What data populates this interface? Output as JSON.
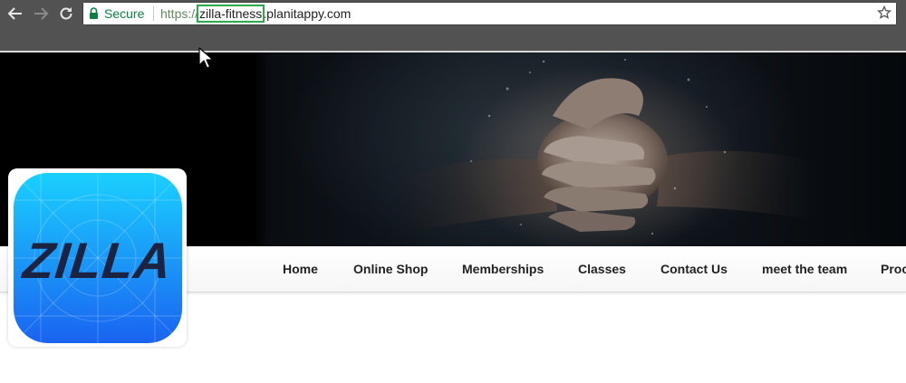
{
  "browser": {
    "secure_label": "Secure",
    "url_protocol": "https://",
    "url_subdomain": "zilla-fitness",
    "url_domain": ".planitappy.com",
    "icons": [
      "back-arrow-icon",
      "forward-arrow-icon",
      "reload-icon",
      "lock-icon",
      "bookmark-star-icon",
      "mouse-cursor-icon"
    ]
  },
  "logo": {
    "text": "ZILLA"
  },
  "nav": {
    "items": [
      {
        "label": "Home"
      },
      {
        "label": "Online Shop"
      },
      {
        "label": "Memberships"
      },
      {
        "label": "Classes"
      },
      {
        "label": "Contact Us"
      },
      {
        "label": "meet the team"
      },
      {
        "label": "Proc"
      }
    ]
  },
  "colors": {
    "chrome": "#525252",
    "secure_green": "#0b8043",
    "highlight_green": "#2ea84a",
    "logo_blue_top": "#1ad0ff",
    "logo_blue_bottom": "#1a63f0",
    "logo_text": "#1c2340"
  }
}
